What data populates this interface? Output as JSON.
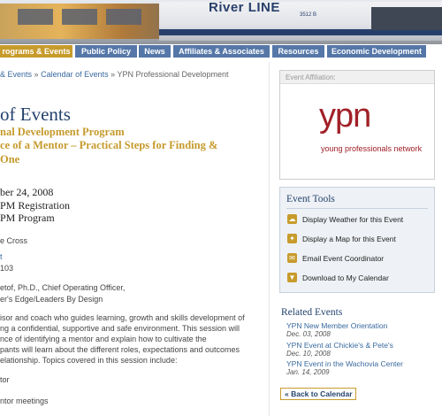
{
  "banner": {
    "train_text": "River LINE",
    "car_number": "3512 B"
  },
  "nav": {
    "tabs": [
      {
        "label": "rograms & Events",
        "active": true
      },
      {
        "label": "Public Policy",
        "active": false
      },
      {
        "label": "News",
        "active": false
      },
      {
        "label": "Affiliates & Associates",
        "active": false
      },
      {
        "label": "Resources",
        "active": false
      },
      {
        "label": "Economic Development",
        "active": false
      }
    ],
    "colors": {
      "active": "#c79b2b",
      "normal": "#5577a8"
    }
  },
  "breadcrumb": {
    "first": "& Events",
    "sep1": "»",
    "second": "Calendar of Events",
    "sep2": "»",
    "current": "YPN Professional Development"
  },
  "event": {
    "page_title": "of Events",
    "subtitle_line1": "nal Development Program",
    "subtitle_line2": "ce of a Mentor – Practical Steps for Finding &",
    "subtitle_line3": "One",
    "date": "ber 24, 2008",
    "time1": "PM Registration",
    "time2": "PM Program",
    "location": "e Cross",
    "map_link": "t",
    "room": "103",
    "speaker_line1": "etof, Ph.D., Chief Operating Officer,",
    "speaker_line2": "er's Edge/Leaders By Design",
    "desc_line1": "isor and coach who guides learning, growth and skills development of",
    "desc_line2": "ng a confidential, supportive and safe environment. This session will",
    "desc_line3": "nce of identifying a mentor and explain how to cultivate the",
    "desc_line4": "pants will learn about the different roles, expectations and outcomes",
    "desc_line5": "elationship. Topics covered in this session include:",
    "topic1": "tor",
    "topic2": "ntor meetings"
  },
  "affiliation": {
    "label": "Event Affiliation:",
    "logo_text": "ypn",
    "logo_tagline": "young professionals network"
  },
  "tools": {
    "title": "Event Tools",
    "items": [
      {
        "label": "Display Weather for this Event",
        "icon": "cloud-icon"
      },
      {
        "label": "Display a Map for this Event",
        "icon": "map-icon"
      },
      {
        "label": "Email Event Coordinator",
        "icon": "envelope-icon"
      },
      {
        "label": "Download to My Calendar",
        "icon": "download-icon"
      }
    ]
  },
  "related": {
    "title": "Related Events",
    "items": [
      {
        "label": "YPN New Member Orientation",
        "date": "Dec. 03, 2008"
      },
      {
        "label": "YPN Event at Chickie's & Pete's",
        "date": "Dec. 10, 2008"
      },
      {
        "label": "YPN Event in the Wachovia Center",
        "date": "Jan. 14, 2009"
      }
    ]
  },
  "back_button": "« Back to Calendar"
}
